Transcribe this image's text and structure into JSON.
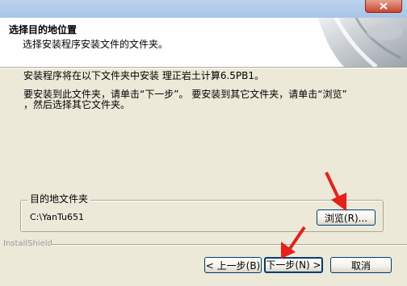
{
  "window": {
    "close_icon": "close-icon"
  },
  "header": {
    "title": "选择目的地位置",
    "subtitle": "选择安装程序安装文件的文件夹。"
  },
  "body": {
    "install_line": "安装程序将在以下文件夹中安装 理正岩土计算6.5PB1。",
    "instruction_line1": "要安装到此文件夹，请单击“下一步”。 要安装到其它文件夹，请单击“浏览”",
    "instruction_line2": "，然后选择其它文件夹。"
  },
  "destination": {
    "group_label": "目的地文件夹",
    "path": "C:\\YanTu651",
    "browse_label": "浏览(R)..."
  },
  "footer": {
    "installshield_label": "InstallShield",
    "back_label": "< 上一步(B)",
    "next_label": "下一步(N) >",
    "cancel_label": "取消"
  },
  "annotations": {
    "arrow_color": "#e8201a"
  }
}
